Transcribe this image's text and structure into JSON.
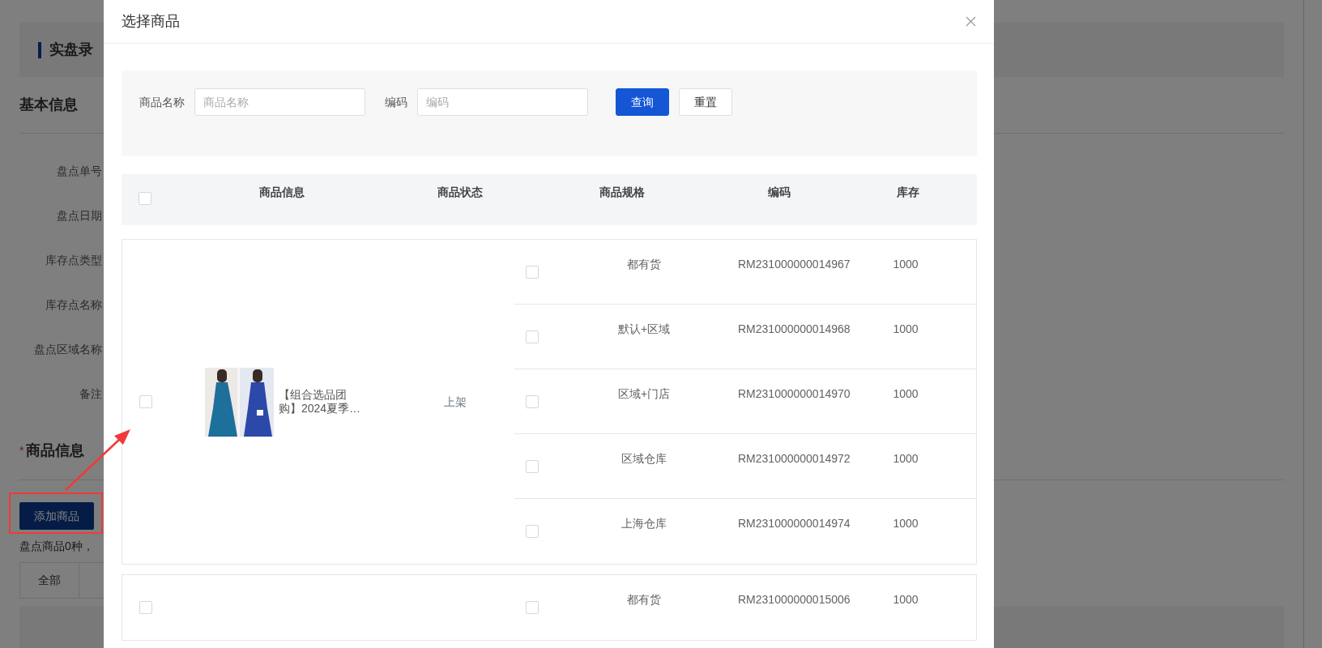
{
  "background": {
    "page_title": "实盘录",
    "section_basic": "基本信息",
    "fields": [
      "盘点单号",
      "盘点日期",
      "库存点类型",
      "库存点名称",
      "盘点区域名称",
      "备注"
    ],
    "section_goods": {
      "required_mark": "*",
      "title": "商品信息"
    },
    "add_button": "添加商品",
    "summary": "盘点商品0种，",
    "tabs": [
      {
        "label": "全部"
      }
    ]
  },
  "modal": {
    "title": "选择商品",
    "search": {
      "fields": [
        {
          "label": "商品名称",
          "placeholder": "商品名称"
        },
        {
          "label": "编码",
          "placeholder": "编码"
        }
      ],
      "buttons": [
        {
          "label": "查询",
          "kind": "primary"
        },
        {
          "label": "重置",
          "kind": "default"
        }
      ]
    },
    "table": {
      "select_all_checked": false,
      "columns": [
        "商品信息",
        "商品状态",
        "商品规格",
        "编码",
        "库存"
      ],
      "products": [
        {
          "checked": false,
          "image": {
            "kind": "picture"
          },
          "name_lines": [
            "【组合选品团",
            "购】2024夏季…"
          ],
          "status": "上架",
          "skus": [
            {
              "checked": false,
              "spec": "都有货",
              "code": "RM231000000014967",
              "stock": "1000"
            },
            {
              "checked": false,
              "spec": "默认+区域",
              "code": "RM231000000014968",
              "stock": "1000"
            },
            {
              "checked": false,
              "spec": "区域+门店",
              "code": "RM231000000014970",
              "stock": "1000"
            },
            {
              "checked": false,
              "spec": "区域仓库",
              "code": "RM231000000014972",
              "stock": "1000"
            },
            {
              "checked": false,
              "spec": "上海仓库",
              "code": "RM231000000014974",
              "stock": "1000"
            }
          ]
        },
        {
          "checked": false,
          "skus": [
            {
              "checked": false,
              "spec": "都有货",
              "code": "RM231000000015006",
              "stock": "1000"
            }
          ]
        }
      ]
    }
  }
}
